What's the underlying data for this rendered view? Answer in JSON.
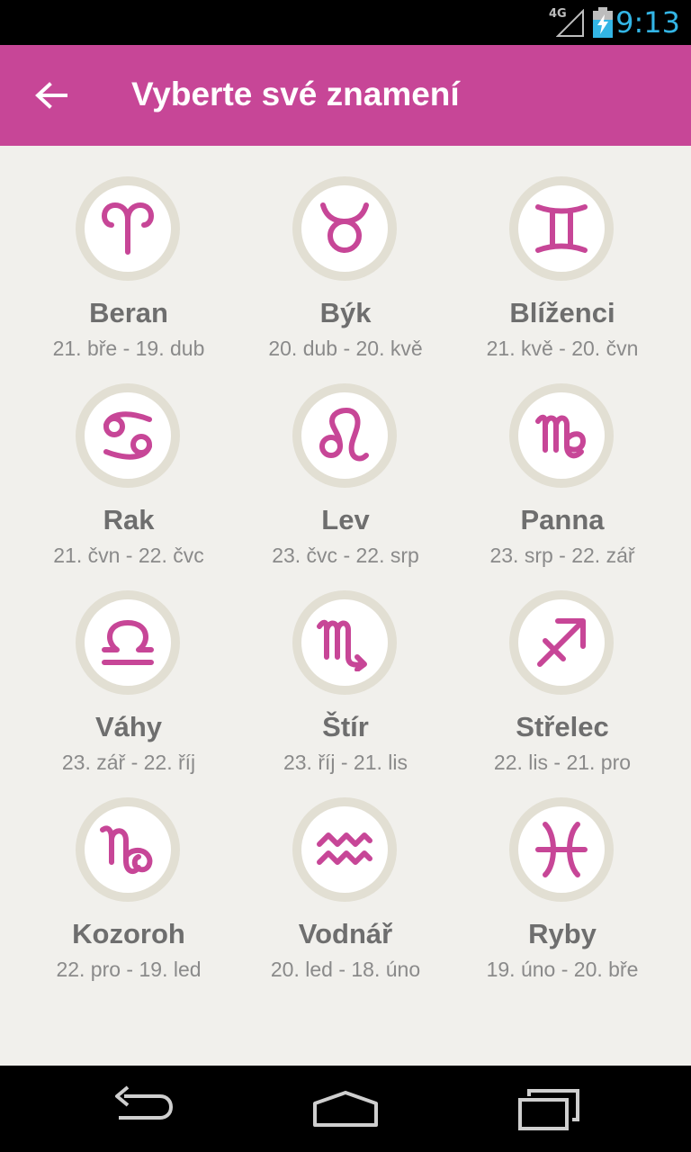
{
  "status_bar": {
    "network": "4G",
    "time": "9:13"
  },
  "app_bar": {
    "title": "Vyberte své znamení",
    "back_icon": "arrow-back-icon"
  },
  "signs": [
    {
      "name": "Beran",
      "dates": "21. bře - 19. dub",
      "icon": "aries-icon"
    },
    {
      "name": "Býk",
      "dates": "20. dub - 20. kvě",
      "icon": "taurus-icon"
    },
    {
      "name": "Blíženci",
      "dates": "21. kvě - 20. čvn",
      "icon": "gemini-icon"
    },
    {
      "name": "Rak",
      "dates": "21. čvn - 22. čvc",
      "icon": "cancer-icon"
    },
    {
      "name": "Lev",
      "dates": "23. čvc - 22. srp",
      "icon": "leo-icon"
    },
    {
      "name": "Panna",
      "dates": "23. srp - 22. zář",
      "icon": "virgo-icon"
    },
    {
      "name": "Váhy",
      "dates": "23. zář - 22. říj",
      "icon": "libra-icon"
    },
    {
      "name": "Štír",
      "dates": "23. říj - 21. lis",
      "icon": "scorpio-icon"
    },
    {
      "name": "Střelec",
      "dates": "22. lis - 21. pro",
      "icon": "sagittarius-icon"
    },
    {
      "name": "Kozoroh",
      "dates": "22. pro - 19. led",
      "icon": "capricorn-icon"
    },
    {
      "name": "Vodnář",
      "dates": "20. led - 18. úno",
      "icon": "aquarius-icon"
    },
    {
      "name": "Ryby",
      "dates": "19. úno - 20. bře",
      "icon": "pisces-icon"
    }
  ],
  "colors": {
    "accent": "#c74697",
    "background": "#f1f0ec",
    "circle_ring": "#e2dfd3",
    "name_text": "#6e6e6e",
    "dates_text": "#8a8a8a"
  },
  "nav_bar": {
    "back": "nav-back-icon",
    "home": "nav-home-icon",
    "recents": "nav-recents-icon"
  }
}
